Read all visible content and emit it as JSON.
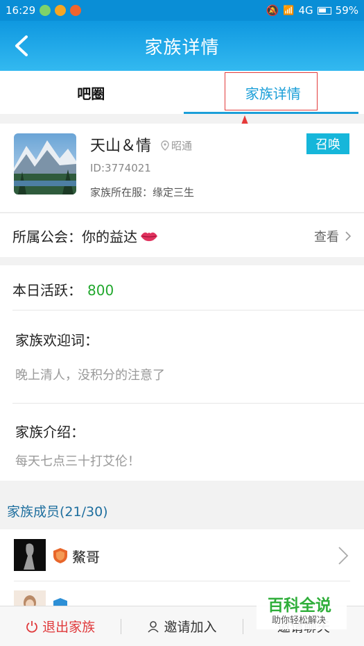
{
  "status_bar": {
    "time": "16:29",
    "network": "4G",
    "battery": "59%"
  },
  "nav": {
    "title": "家族详情"
  },
  "tabs": [
    {
      "label": "吧圈"
    },
    {
      "label": "家族详情"
    }
  ],
  "family": {
    "name": "天山＆情",
    "location": "昭通",
    "id": "ID:3774021",
    "server": "家族所在服：缘定三生",
    "summon_label": "召唤"
  },
  "guild": {
    "label": "所属公会：你的益达",
    "view_label": "查看"
  },
  "activity": {
    "label": "本日活跃：",
    "value": "800"
  },
  "welcome": {
    "title": "家族欢迎词：",
    "text": "晚上清人，没积分的注意了"
  },
  "intro": {
    "title": "家族介绍：",
    "text": "每天七点三十打艾伦！"
  },
  "members": {
    "header": "家族成员(21/30)",
    "list": [
      {
        "name": "鰲哥"
      }
    ]
  },
  "bottom": {
    "quit": "退出家族",
    "invite": "邀请加入",
    "chat": "邀请聊天"
  },
  "watermark": {
    "title": "百科全说",
    "subtitle": "助你轻松解决"
  },
  "colors": {
    "primary": "#1b9fd8",
    "accent_green": "#22a82e",
    "danger": "#e0393b",
    "summon": "#16b6da"
  }
}
